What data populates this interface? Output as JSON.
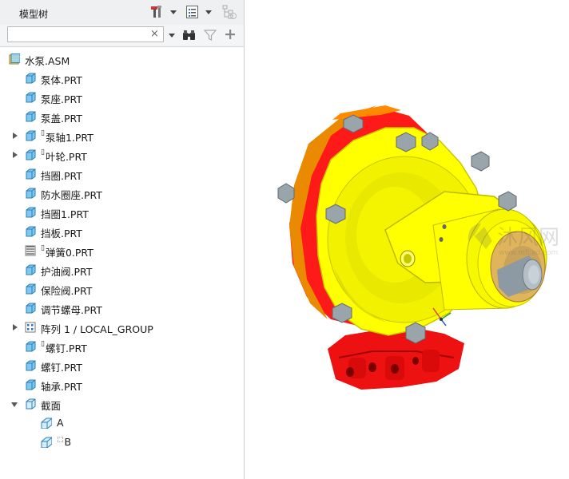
{
  "panel": {
    "title": "模型树",
    "search": {
      "value": "",
      "placeholder": ""
    }
  },
  "tree": {
    "root": "水泵.ASM",
    "items": [
      {
        "label": "泵体.PRT",
        "icon": "part-icon"
      },
      {
        "label": "泵座.PRT",
        "icon": "part-icon"
      },
      {
        "label": "泵盖.PRT",
        "icon": "part-icon"
      },
      {
        "label": "泵轴1.PRT",
        "icon": "part-icon",
        "expandable": true,
        "marker": "▯"
      },
      {
        "label": "叶轮.PRT",
        "icon": "part-icon",
        "expandable": true,
        "marker": "▯"
      },
      {
        "label": "挡圈.PRT",
        "icon": "part-icon"
      },
      {
        "label": "防水圈座.PRT",
        "icon": "part-icon"
      },
      {
        "label": "挡圈1.PRT",
        "icon": "part-icon"
      },
      {
        "label": "挡板.PRT",
        "icon": "part-icon"
      },
      {
        "label": "弹簧0.PRT",
        "icon": "spring-part-icon",
        "marker": "▯"
      },
      {
        "label": "护油阀.PRT",
        "icon": "part-icon"
      },
      {
        "label": "保险阀.PRT",
        "icon": "part-icon"
      },
      {
        "label": "调节螺母.PRT",
        "icon": "part-icon"
      },
      {
        "label": "阵列 1 / LOCAL_GROUP",
        "icon": "pattern-icon",
        "expandable": true
      },
      {
        "label": "螺钉.PRT",
        "icon": "part-icon",
        "marker": "▯"
      },
      {
        "label": "螺钉.PRT",
        "icon": "part-icon"
      },
      {
        "label": "轴承.PRT",
        "icon": "part-icon"
      }
    ],
    "sections": {
      "label": "截面",
      "children": [
        {
          "label": "A",
          "icon": "section-plane-icon"
        },
        {
          "label": "B",
          "icon": "section-plane-icon",
          "marker": "⬚"
        }
      ]
    }
  },
  "viewport": {
    "watermark_text": "沐风网",
    "watermark_url": "www.mfcad.com"
  },
  "colors": {
    "housing_red": "#ee1111",
    "housing_yellow": "#f0f000",
    "shaft_gray": "#9aa7b0",
    "bearing_orange": "#c9a35a"
  }
}
